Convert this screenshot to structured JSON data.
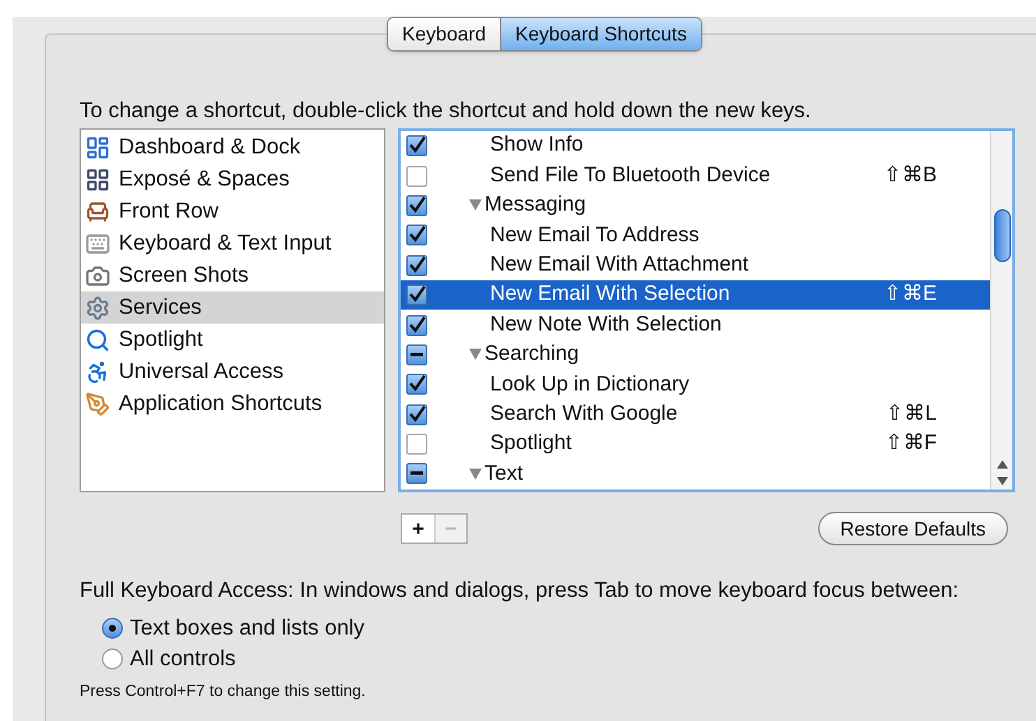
{
  "tabs": [
    {
      "label": "Keyboard",
      "selected": false
    },
    {
      "label": "Keyboard Shortcuts",
      "selected": true
    }
  ],
  "instruction": "To change a shortcut, double-click the shortcut and hold down the new keys.",
  "categories": [
    {
      "label": "Dashboard & Dock",
      "selected": false
    },
    {
      "label": "Exposé & Spaces",
      "selected": false
    },
    {
      "label": "Front Row",
      "selected": false
    },
    {
      "label": "Keyboard & Text Input",
      "selected": false
    },
    {
      "label": "Screen Shots",
      "selected": false
    },
    {
      "label": "Services",
      "selected": true
    },
    {
      "label": "Spotlight",
      "selected": false
    },
    {
      "label": "Universal Access",
      "selected": false
    },
    {
      "label": "Application Shortcuts",
      "selected": false
    }
  ],
  "shortcuts": [
    {
      "kind": "item",
      "label": "Show Info",
      "checked": true,
      "selected": false
    },
    {
      "kind": "item",
      "label": "Send File To Bluetooth Device",
      "shortcut": "⇧⌘B",
      "checked": false,
      "selected": false
    },
    {
      "kind": "group",
      "label": "Messaging",
      "checked": true,
      "expanded": true,
      "selected": false
    },
    {
      "kind": "item",
      "label": "New Email To Address",
      "checked": true,
      "selected": false
    },
    {
      "kind": "item",
      "label": "New Email With Attachment",
      "checked": true,
      "selected": false
    },
    {
      "kind": "item",
      "label": "New Email With Selection",
      "shortcut": "⇧⌘E",
      "checked": true,
      "selected": true
    },
    {
      "kind": "item",
      "label": "New Note With Selection",
      "checked": true,
      "selected": false
    },
    {
      "kind": "group",
      "label": "Searching",
      "mixed": true,
      "expanded": true,
      "selected": false
    },
    {
      "kind": "item",
      "label": "Look Up in Dictionary",
      "checked": true,
      "selected": false
    },
    {
      "kind": "item",
      "label": "Search With Google",
      "shortcut": "⇧⌘L",
      "checked": true,
      "selected": false
    },
    {
      "kind": "item",
      "label": "Spotlight",
      "shortcut": "⇧⌘F",
      "checked": false,
      "selected": false
    },
    {
      "kind": "group",
      "label": "Text",
      "mixed": true,
      "expanded": true,
      "selected": false
    }
  ],
  "add_button": {
    "label": "+",
    "disabled": false
  },
  "remove_button": {
    "label": "−",
    "disabled": true
  },
  "restore_button": "Restore Defaults",
  "full_keyboard_access": {
    "label": "Full Keyboard Access: In windows and dialogs, press Tab to move keyboard focus between:",
    "options": [
      {
        "label": "Text boxes and lists only",
        "selected": true
      },
      {
        "label": "All controls",
        "selected": false
      }
    ]
  },
  "hint": "Press Control+F7 to change this setting."
}
